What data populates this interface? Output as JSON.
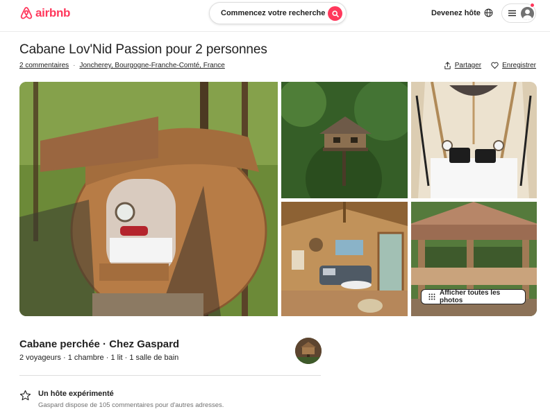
{
  "header": {
    "logo_text": "airbnb",
    "search_placeholder": "Commencez votre recherche",
    "host_link": "Devenez hôte"
  },
  "listing": {
    "title": "Cabane Lov'Nid Passion pour 2 personnes",
    "reviews_link": "2 commentaires",
    "separator": "·",
    "location": "Joncherey, Bourgogne-Franche-Comté, France",
    "share_label": "Partager",
    "save_label": "Enregistrer"
  },
  "gallery": {
    "show_all_label": "Afficher toutes les photos"
  },
  "details": {
    "subtitle": "Cabane perchée · Chez Gaspard",
    "specs": "2 voyageurs · 1 chambre · 1 lit · 1 salle de bain"
  },
  "highlight": {
    "title": "Un hôte expérimenté",
    "description": "Gaspard dispose de 105 commentaires pour d'autres adresses."
  },
  "colors": {
    "brand": "#ff385c",
    "text": "#222222",
    "secondary_text": "#717171"
  },
  "icons": [
    "airbnb-logo-icon",
    "search-icon",
    "globe-icon",
    "menu-icon",
    "user-avatar-icon",
    "share-icon",
    "heart-icon",
    "grid-icon",
    "star-icon"
  ]
}
